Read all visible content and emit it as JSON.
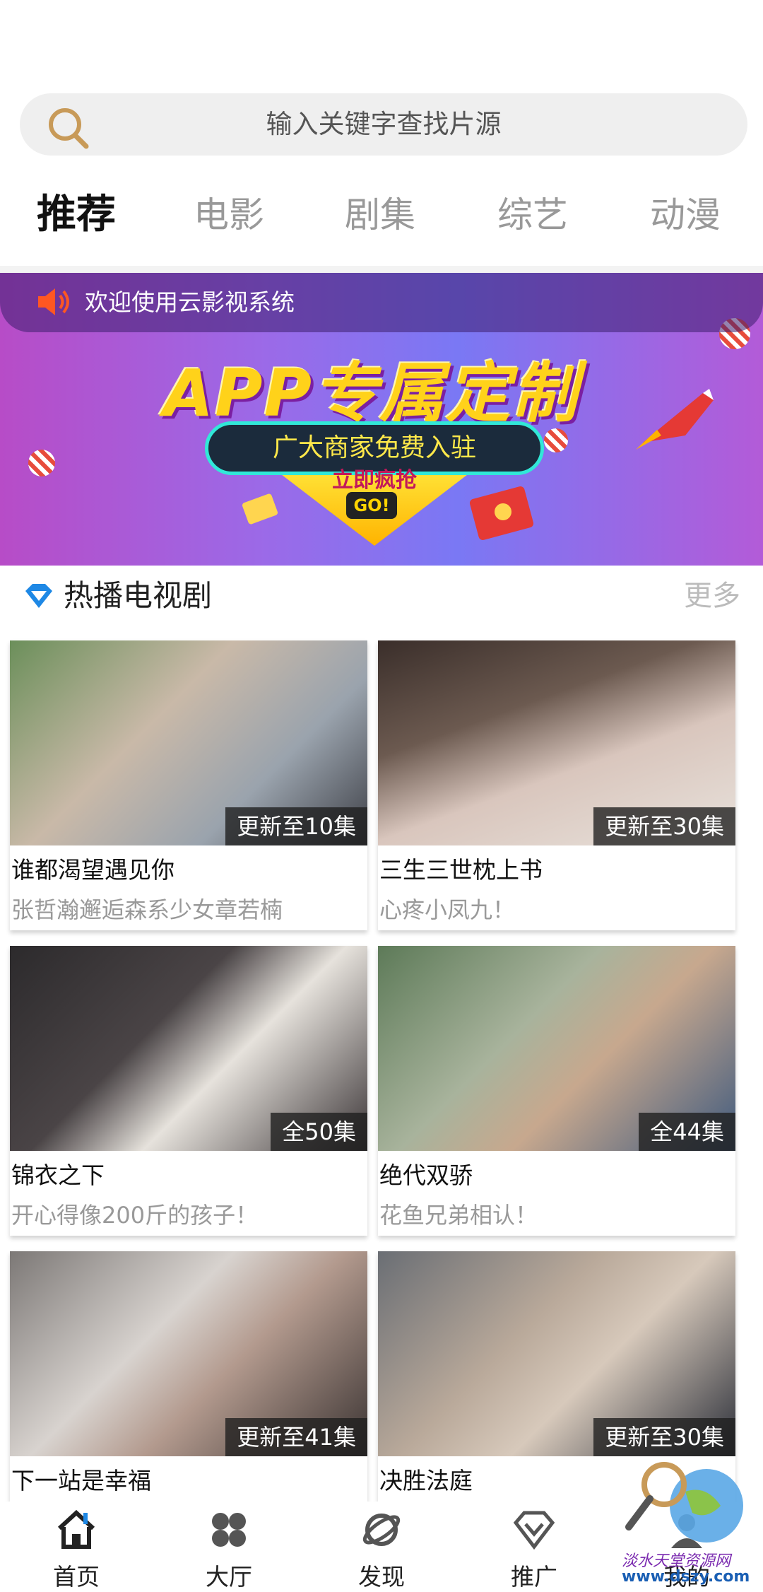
{
  "search": {
    "placeholder": "输入关键字查找片源",
    "icon": "search-icon"
  },
  "tabs": [
    {
      "label": "推荐",
      "active": true
    },
    {
      "label": "电影",
      "active": false
    },
    {
      "label": "剧集",
      "active": false
    },
    {
      "label": "综艺",
      "active": false
    },
    {
      "label": "动漫",
      "active": false
    }
  ],
  "banner": {
    "notice": "欢迎使用云影视系统",
    "headline": "APP专属定制",
    "subline": "广大商家免费入驻",
    "cta": "立即疯抢",
    "cta_go": "GO!"
  },
  "section": {
    "title": "热播电视剧",
    "more": "更多"
  },
  "cards": [
    {
      "title": "谁都渴望遇见你",
      "desc": "张哲瀚邂逅森系少女章若楠",
      "badge": "更新至10集"
    },
    {
      "title": "三生三世枕上书",
      "desc": "心疼小凤九！",
      "badge": "更新至30集"
    },
    {
      "title": "锦衣之下",
      "desc": "开心得像200斤的孩子！",
      "badge": "全50集"
    },
    {
      "title": "绝代双骄",
      "desc": "花鱼兄弟相认！",
      "badge": "全44集"
    },
    {
      "title": "下一站是幸福",
      "desc": "",
      "badge": "更新至41集"
    },
    {
      "title": "决胜法庭",
      "desc": "",
      "badge": "更新至30集"
    }
  ],
  "nav": [
    {
      "label": "首页",
      "icon": "home-icon"
    },
    {
      "label": "大厅",
      "icon": "grid-icon"
    },
    {
      "label": "发现",
      "icon": "planet-icon"
    },
    {
      "label": "推广",
      "icon": "diamond-icon"
    },
    {
      "label": "我的",
      "icon": "user-icon"
    }
  ],
  "watermark": {
    "line1": "淡水天堂资源网",
    "line2": "www.dszy.com"
  },
  "colors": {
    "banner_start": "#b74cc7",
    "banner_end": "#7a78f4",
    "accent_blue": "#1e88e5"
  }
}
